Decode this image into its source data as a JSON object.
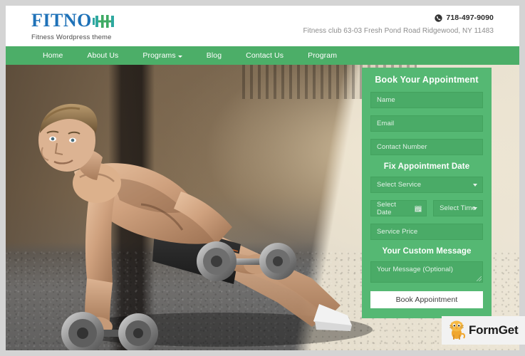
{
  "header": {
    "logo_word": "FITNO",
    "logo_icon": "dumbbell-h-icon",
    "tagline": "Fitness Wordpress theme",
    "phone_icon": "phone-icon",
    "phone": "718-497-9090",
    "address": "Fitness club 63-03 Fresh Pond Road Ridgewood, NY 11483"
  },
  "nav": {
    "items": [
      {
        "label": "Home",
        "has_dropdown": false
      },
      {
        "label": "About Us",
        "has_dropdown": false
      },
      {
        "label": "Programs",
        "has_dropdown": true
      },
      {
        "label": "Blog",
        "has_dropdown": false
      },
      {
        "label": "Contact Us",
        "has_dropdown": false
      },
      {
        "label": "Program",
        "has_dropdown": false
      }
    ]
  },
  "hero": {
    "alt": "Muscular shirtless man performing a one-arm plank with a dumbbell in an industrial gym"
  },
  "form": {
    "title": "Book Your Appointment",
    "name_placeholder": "Name",
    "email_placeholder": "Email",
    "contact_placeholder": "Contact Number",
    "date_section_title": "Fix Appointment Date",
    "service_placeholder": "Select Service",
    "date_placeholder": "Select Date",
    "date_icon": "calendar-icon",
    "time_placeholder": "Select Time",
    "price_placeholder": "Service Price",
    "message_section_title": "Your Custom Message",
    "message_placeholder": "Your Message (Optional)",
    "submit_label": "Book Appointment"
  },
  "watermark": {
    "brand": "FormGet",
    "mascot_icon": "cat-mascot-icon"
  },
  "colors": {
    "nav_green": "#4cae68",
    "panel_green": "#55b873",
    "field_green": "#4aab67",
    "logo_blue": "#1f72b8",
    "logo_green": "#3eaa63",
    "logo_teal": "#2fa8a0"
  }
}
